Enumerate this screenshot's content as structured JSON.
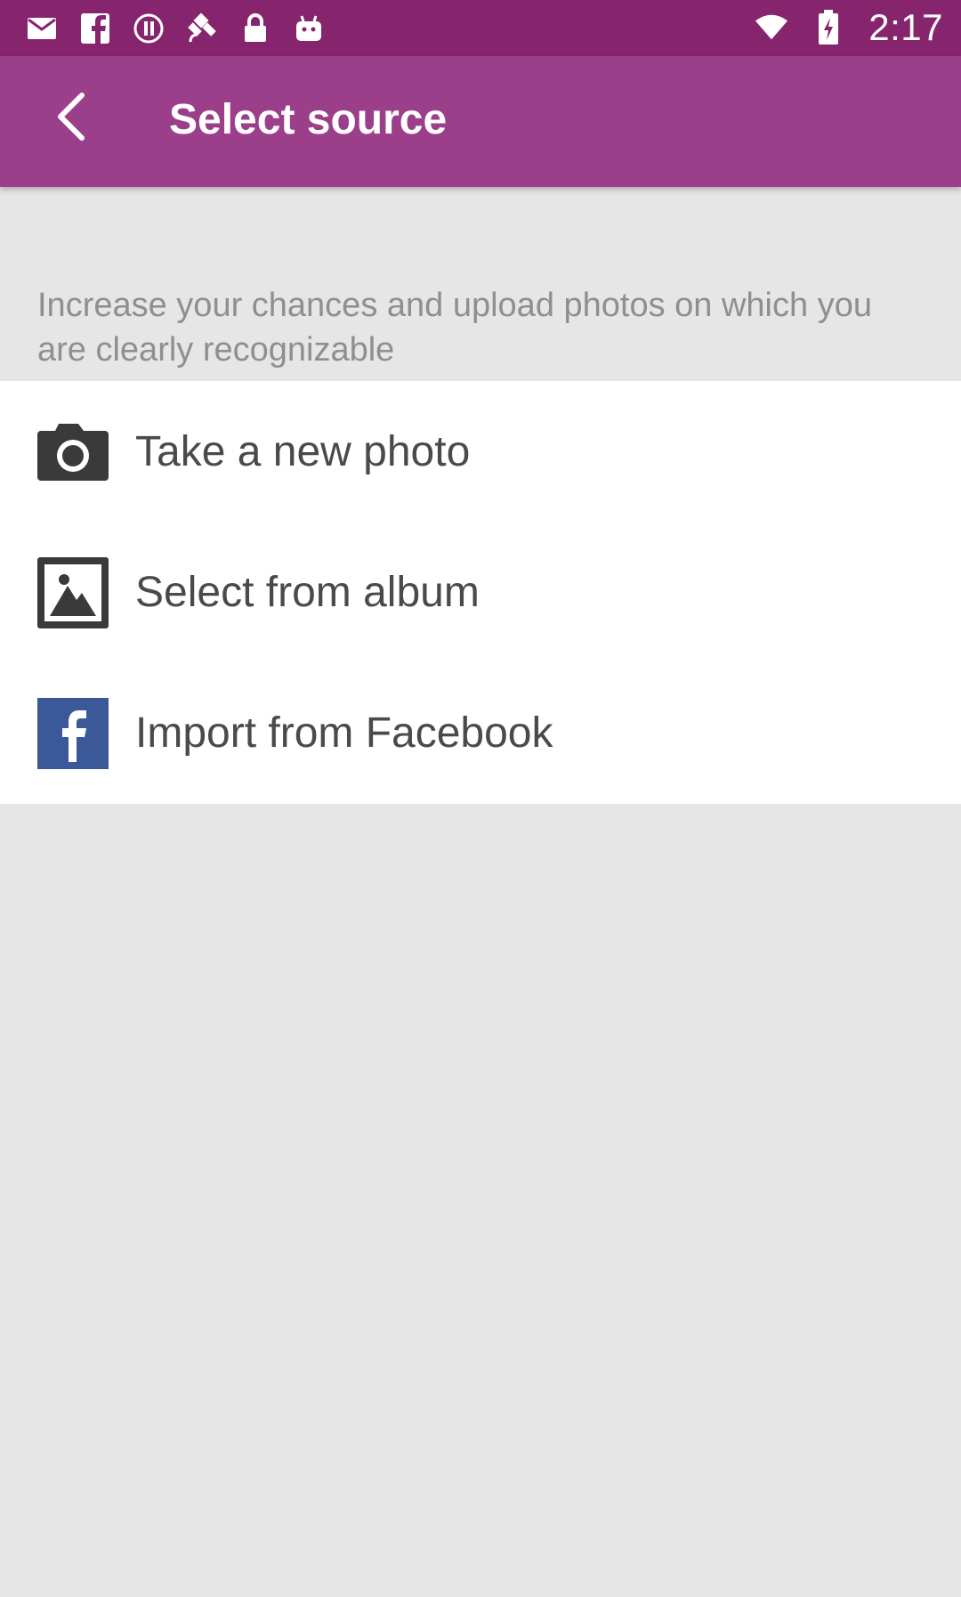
{
  "status_bar": {
    "time": "2:17",
    "icons": [
      "mail-icon",
      "facebook-notification-icon",
      "info-icon",
      "satellite-icon",
      "lock-icon",
      "android-icon",
      "wifi-icon",
      "battery-icon"
    ]
  },
  "app_bar": {
    "title": "Select source",
    "back_icon": "chevron-left-icon"
  },
  "hint": {
    "text": "Increase your chances and upload photos on which you are clearly recognizable"
  },
  "options": [
    {
      "label": "Take a new photo",
      "icon": "camera-icon"
    },
    {
      "label": "Select from album",
      "icon": "album-icon"
    },
    {
      "label": "Import from Facebook",
      "icon": "facebook-icon"
    }
  ],
  "colors": {
    "status_bar": "#87246e",
    "app_bar": "#9c3f8a",
    "background": "#e6e6e6",
    "panel": "#ffffff",
    "facebook_blue": "#3b5998",
    "icon_dark": "#3a3a3a",
    "label_text": "#4a4a4a",
    "hint_text": "#8f8f8f"
  }
}
